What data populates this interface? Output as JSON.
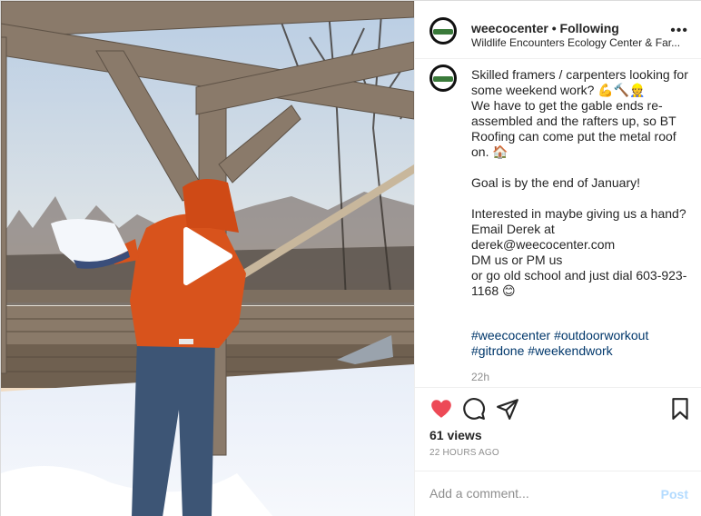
{
  "media": {
    "type": "video",
    "play_icon": "play-icon"
  },
  "header": {
    "username": "weecocenter",
    "separator": " • ",
    "follow_status": "Following",
    "location": "Wildlife Encounters Ecology Center & Far...",
    "more_icon": "more-horizontal-icon",
    "more_label": "•••"
  },
  "caption": {
    "text": "Skilled framers / carpenters looking for some weekend work? 💪🔨👷\nWe have to get the gable ends re-assembled and the rafters up, so BT Roofing can come put the metal roof on. 🏠\n\nGoal is by the end of January!\n\nInterested in maybe giving us a hand?\nEmail Derek at derek@weecocenter.com\nDM us or PM us\nor go old school and just dial 603-923-1168 😊",
    "hashtags": [
      "#weecocenter",
      "#outdoorworkout",
      "#gitrdone",
      "#weekendwork"
    ],
    "time_ago": "22h"
  },
  "actions": {
    "icons": [
      "heart-icon",
      "comment-icon",
      "share-icon",
      "bookmark-icon"
    ],
    "like_color": "#ed4956"
  },
  "stats": {
    "views": "61 views",
    "posted": "22 HOURS AGO"
  },
  "comment": {
    "placeholder": "Add a comment...",
    "post_label": "Post",
    "post_color": "#b3dbff"
  }
}
